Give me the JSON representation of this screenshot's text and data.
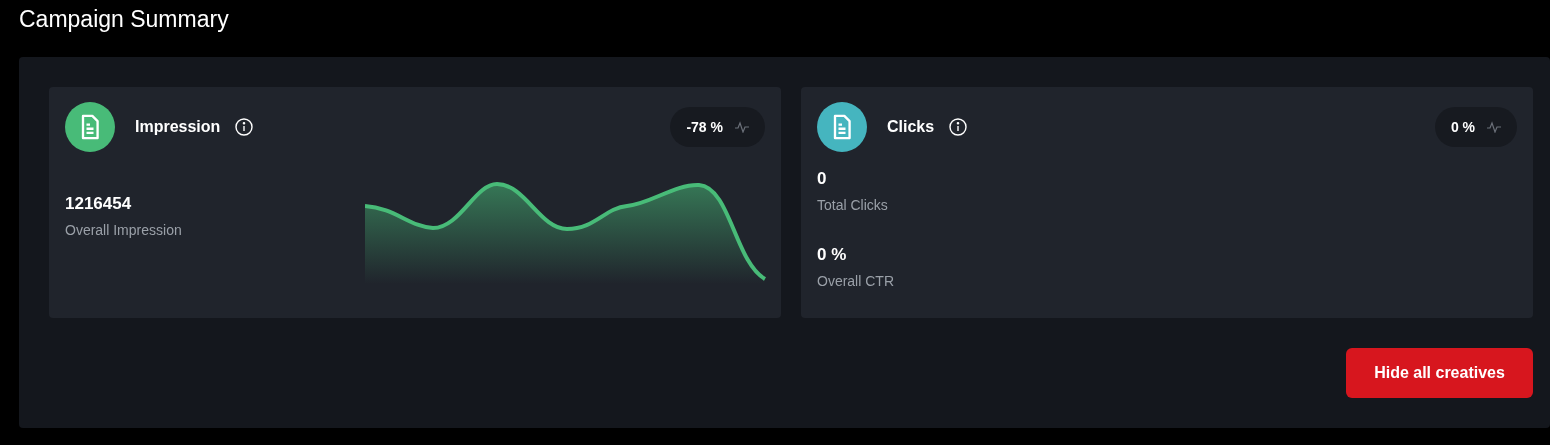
{
  "page_title": "Campaign Summary",
  "cards": [
    {
      "kind": "chart",
      "title": "Impression",
      "color": "#48bb78",
      "badge": "-78 %",
      "stats": [
        {
          "value": "1216454",
          "label": "Overall Impression"
        }
      ]
    },
    {
      "kind": "stats",
      "title": "Clicks",
      "color": "#45b5bf",
      "badge": "0 %",
      "stats": [
        {
          "value": "0",
          "label": "Total Clicks"
        },
        {
          "value": "0 %",
          "label": "Overall CTR"
        }
      ]
    }
  ],
  "hide_button": "Hide all creatives"
}
